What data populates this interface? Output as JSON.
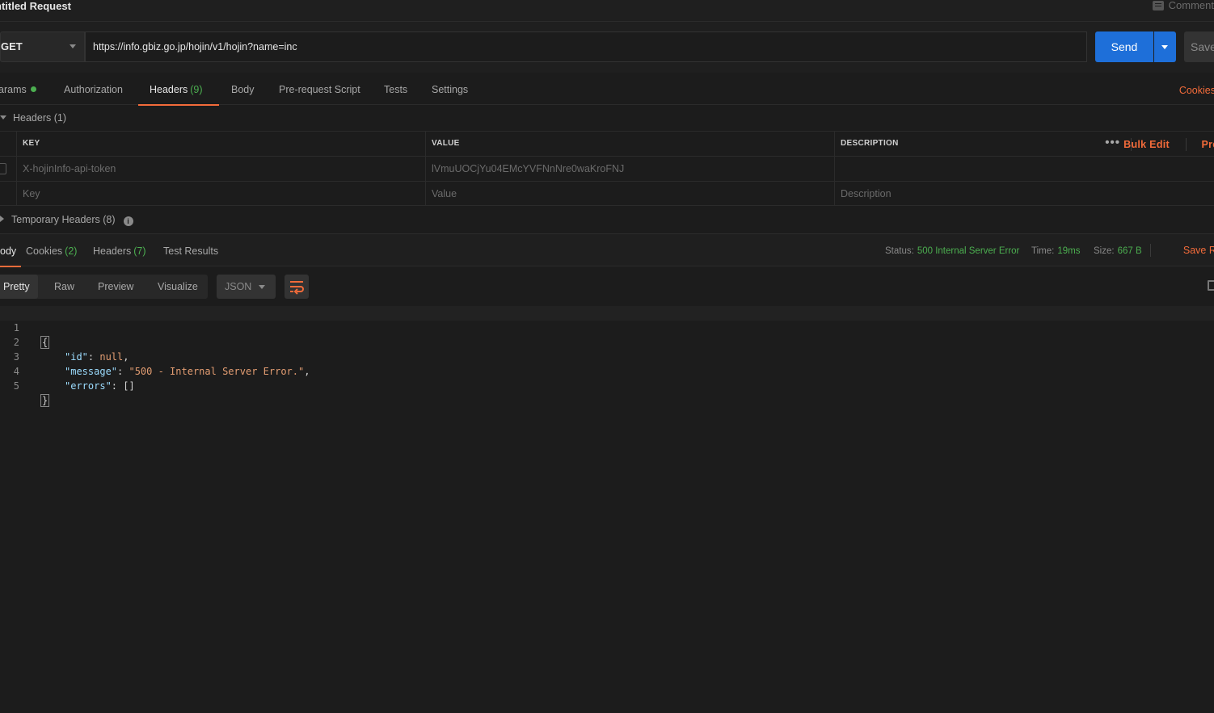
{
  "request": {
    "title": "ntitled Request",
    "comments_label": "Comment",
    "method": "GET",
    "url": "https://info.gbiz.go.jp/hojin/v1/hojin?name=inc",
    "send_label": "Send",
    "save_label": "Save"
  },
  "request_tabs": [
    {
      "label": "arams",
      "count": "",
      "dot": true
    },
    {
      "label": "Authorization",
      "count": ""
    },
    {
      "label": "Headers",
      "count": "(9)",
      "active": true
    },
    {
      "label": "Body",
      "count": ""
    },
    {
      "label": "Pre-request Script",
      "count": ""
    },
    {
      "label": "Tests",
      "count": ""
    },
    {
      "label": "Settings",
      "count": ""
    }
  ],
  "cookies_link": "Cookies",
  "headers": {
    "section_label": "Headers (1)",
    "columns": {
      "key": "KEY",
      "value": "VALUE",
      "description": "DESCRIPTION"
    },
    "more_icon": "•••",
    "bulk_edit": "Bulk Edit",
    "presets": "Prese",
    "rows": [
      {
        "key": "X-hojinInfo-api-token",
        "value": "lVmuUOCjYu04EMcYVFNnNre0waKroFNJ",
        "description": ""
      }
    ],
    "placeholders": {
      "key": "Key",
      "value": "Value",
      "description": "Description"
    },
    "temporary_label": "Temporary Headers (8)",
    "info_icon": "i"
  },
  "response_tabs": [
    {
      "label": "ody",
      "count": "",
      "active": true
    },
    {
      "label": "Cookies",
      "count": "(2)"
    },
    {
      "label": "Headers",
      "count": "(7)"
    },
    {
      "label": "Test Results",
      "count": ""
    }
  ],
  "response_meta": {
    "status_label": "Status:",
    "status_value": "500 Internal Server Error",
    "time_label": "Time:",
    "time_value": "19ms",
    "size_label": "Size:",
    "size_value": "667 B",
    "save_response": "Save Respo"
  },
  "body_toolbar": {
    "modes": [
      "Pretty",
      "Raw",
      "Preview",
      "Visualize"
    ],
    "active_mode": "Pretty",
    "format": "JSON"
  },
  "code": {
    "line_numbers": [
      "1",
      "2",
      "3",
      "4",
      "5"
    ],
    "open_brace": "{",
    "close_brace": "}",
    "id_key": "\"id\"",
    "id_val": "null",
    "message_key": "\"message\"",
    "message_val": "\"500 - Internal Server Error.\"",
    "errors_key": "\"errors\"",
    "errors_val": "[]"
  },
  "colors": {
    "accent": "#f26b3a",
    "send": "#1e6fd9",
    "success": "#4caf50"
  }
}
